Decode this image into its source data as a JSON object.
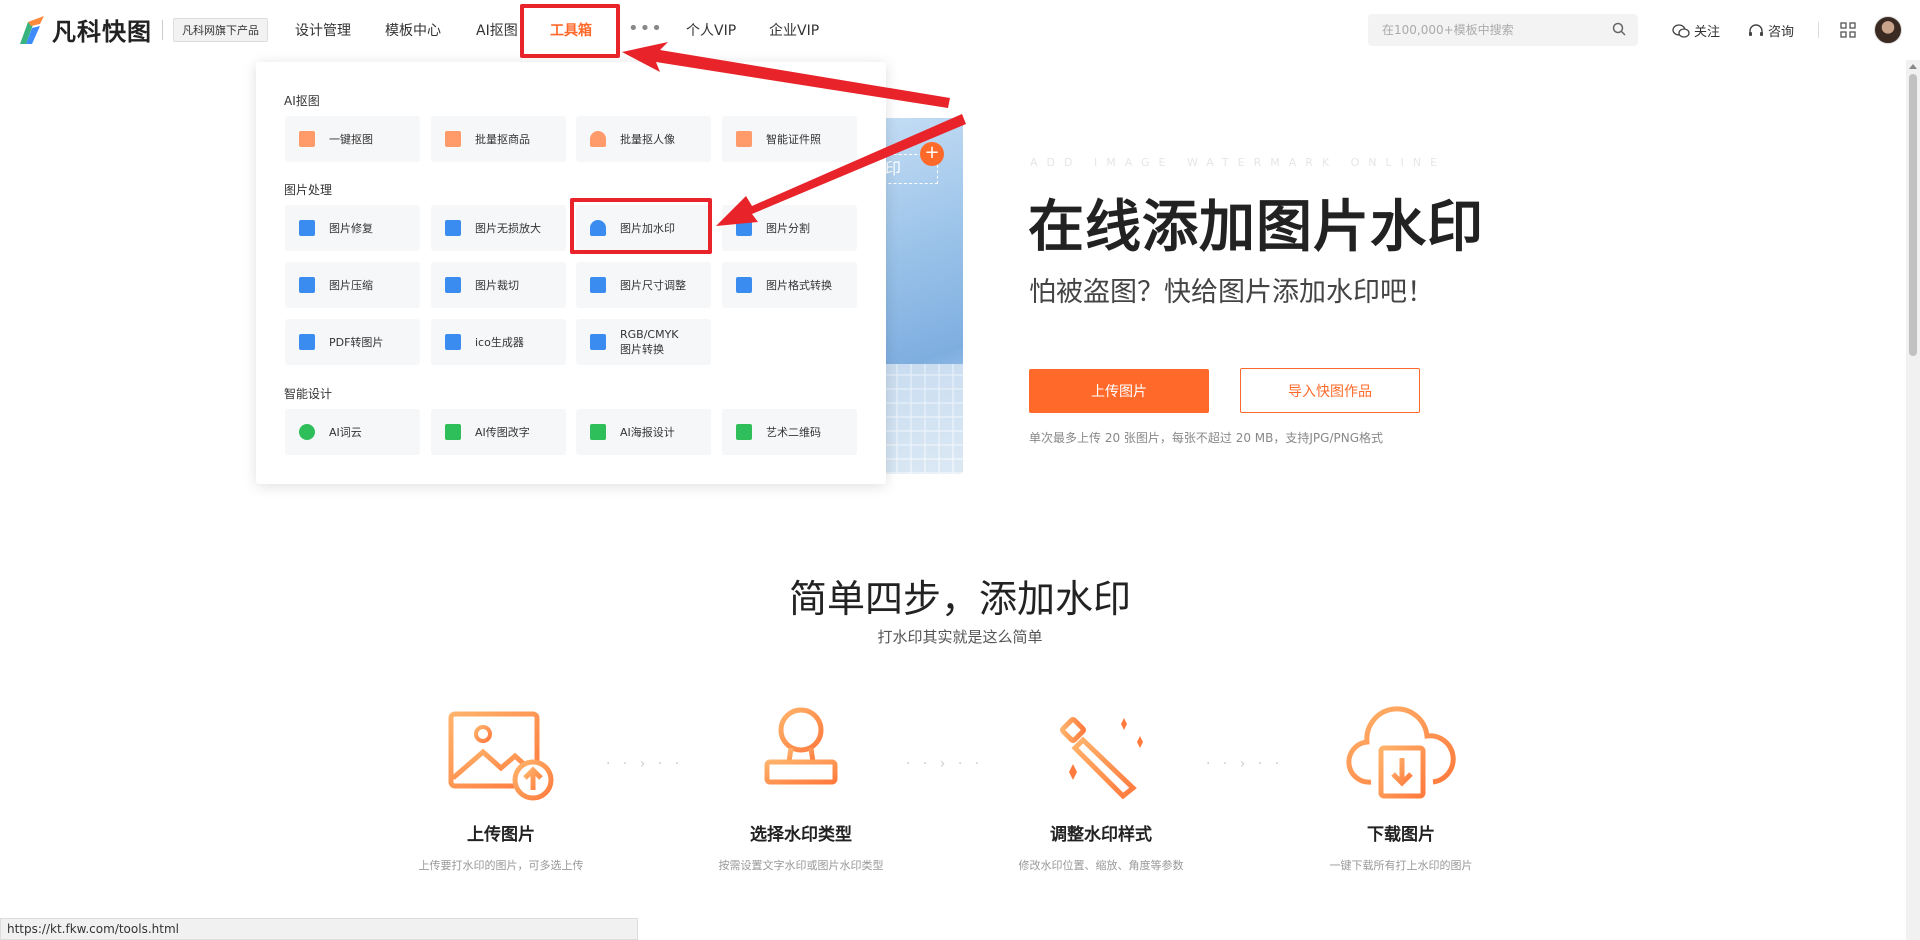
{
  "nav": {
    "logo_text": "凡科快图",
    "brand_tag": "凡科网旗下产品",
    "items": [
      "设计管理",
      "模板中心",
      "AI抠图",
      "工具箱",
      "个人VIP",
      "企业VIP"
    ],
    "more": "•••",
    "search_placeholder": "在100,000+模板中搜索",
    "follow": "关注",
    "consult": "咨询"
  },
  "dropdown": {
    "groups": [
      {
        "title": "AI抠图",
        "items": [
          {
            "label": "一键抠图",
            "icon": "cutout-icon",
            "color": "#ff8a5b"
          },
          {
            "label": "批量抠商品",
            "icon": "bag-icon",
            "color": "#ff8a5b"
          },
          {
            "label": "批量抠人像",
            "icon": "person-icon",
            "color": "#ff8a5b"
          },
          {
            "label": "智能证件照",
            "icon": "id-photo-icon",
            "color": "#ff8a5b"
          }
        ]
      },
      {
        "title": "图片处理",
        "items": [
          {
            "label": "图片修复",
            "icon": "wrench-icon",
            "color": "#3b8cf0"
          },
          {
            "label": "图片无损放大",
            "icon": "enlarge-icon",
            "color": "#3b8cf0"
          },
          {
            "label": "图片加水印",
            "icon": "stamp-icon",
            "color": "#3b8cf0"
          },
          {
            "label": "图片分割",
            "icon": "split-icon",
            "color": "#3b8cf0"
          },
          {
            "label": "图片压缩",
            "icon": "compress-icon",
            "color": "#3b8cf0"
          },
          {
            "label": "图片裁切",
            "icon": "crop-icon",
            "color": "#3b8cf0"
          },
          {
            "label": "图片尺寸调整",
            "icon": "resize-icon",
            "color": "#3b8cf0"
          },
          {
            "label": "图片格式转换",
            "icon": "convert-icon",
            "color": "#3b8cf0"
          },
          {
            "label": "PDF转图片",
            "icon": "pdf-icon",
            "color": "#3b8cf0"
          },
          {
            "label": "ico生成器",
            "icon": "ico-icon",
            "color": "#3b8cf0"
          },
          {
            "label": "RGB/CMYK\n图片转换",
            "icon": "color-mode-icon",
            "color": "#3b8cf0"
          }
        ]
      },
      {
        "title": "智能设计",
        "items": [
          {
            "label": "AI词云",
            "icon": "cloud-icon",
            "color": "#2fbf5a"
          },
          {
            "label": "AI传图改字",
            "icon": "text-edit-icon",
            "color": "#2fbf5a"
          },
          {
            "label": "AI海报设计",
            "icon": "robot-icon",
            "color": "#2fbf5a"
          },
          {
            "label": "艺术二维码",
            "icon": "qrcode-icon",
            "color": "#2fbf5a"
          }
        ]
      }
    ]
  },
  "hero": {
    "eng": "ADD IMAGE WATERMARK ONLINE",
    "title": "在线添加图片水印",
    "subtitle": "怕被盗图？快给图片添加水印吧！",
    "upload_btn": "上传图片",
    "import_btn": "导入快图作品",
    "note": "单次最多上传 20 张图片，每张不超过 20 MB，支持JPG/PNG格式",
    "watermark_char": "印"
  },
  "steps_section": {
    "title": "简单四步，添加水印",
    "subtitle": "打水印其实就是这么简单",
    "steps": [
      {
        "title": "上传图片",
        "desc": "上传要打水印的图片，可多选上传",
        "icon": "upload-image-icon"
      },
      {
        "title": "选择水印类型",
        "desc": "按需设置文字水印或图片水印类型",
        "icon": "stamp-icon"
      },
      {
        "title": "调整水印样式",
        "desc": "修改水印位置、缩放、角度等参数",
        "icon": "magic-wand-icon"
      },
      {
        "title": "下载图片",
        "desc": "一键下载所有打上水印的图片",
        "icon": "cloud-download-icon"
      }
    ]
  },
  "status_url": "https://kt.fkw.com/tools.html",
  "colors": {
    "accent": "#ff6a2b",
    "highlight": "#e8232a"
  }
}
